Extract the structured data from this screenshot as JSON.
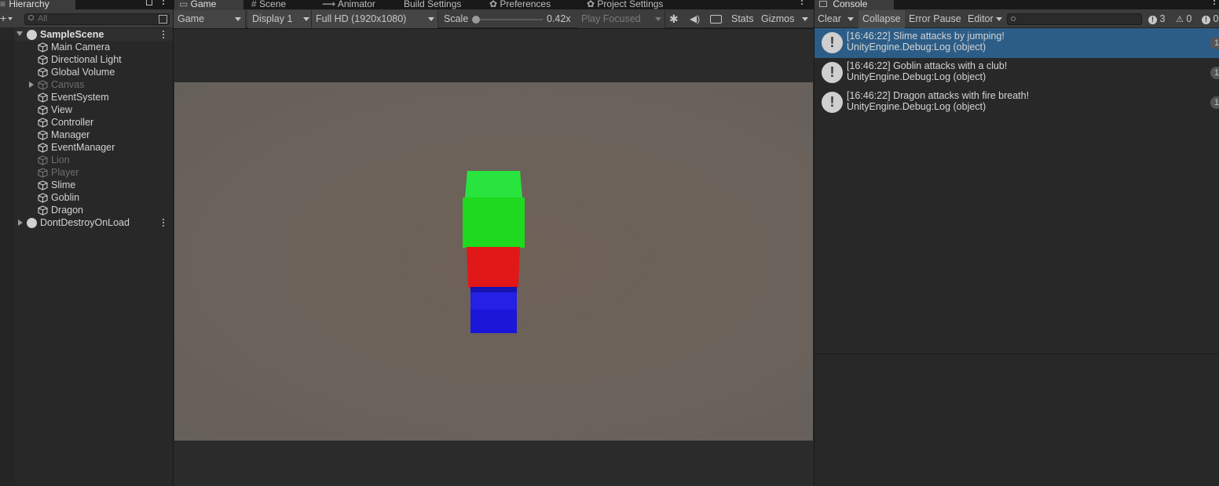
{
  "hierarchy": {
    "tab_label": "Hierarchy",
    "search_placeholder": "All",
    "scene_name": "SampleScene",
    "items": [
      {
        "label": "Main Camera",
        "dim": false
      },
      {
        "label": "Directional Light",
        "dim": false
      },
      {
        "label": "Global Volume",
        "dim": false
      },
      {
        "label": "Canvas",
        "dim": true
      },
      {
        "label": "EventSystem",
        "dim": false
      },
      {
        "label": "View",
        "dim": false
      },
      {
        "label": "Controller",
        "dim": false
      },
      {
        "label": "Manager",
        "dim": false
      },
      {
        "label": "EventManager",
        "dim": false
      },
      {
        "label": "Lion",
        "dim": true
      },
      {
        "label": "Player",
        "dim": true
      },
      {
        "label": "Slime",
        "dim": false
      },
      {
        "label": "Goblin",
        "dim": false
      },
      {
        "label": "Dragon",
        "dim": false
      }
    ],
    "dontdestroy_name": "DontDestroyOnLoad"
  },
  "center_tabs": [
    "Game",
    "Scene",
    "Animator",
    "Build Settings",
    "Preferences",
    "Project Settings"
  ],
  "game_toolbar": {
    "view_mode": "Game",
    "display": "Display 1",
    "resolution": "Full HD (1920x1080)",
    "scale_label": "Scale",
    "scale_value": "0.42x",
    "play_mode": "Play Focused",
    "stats": "Stats",
    "gizmos": "Gizmos"
  },
  "game_view": {
    "background_color": "#6b625b",
    "cubes": [
      {
        "name": "green-cube",
        "color": "#1ed91e"
      },
      {
        "name": "red-cube",
        "color": "#e01818"
      },
      {
        "name": "blue-cube",
        "color": "#1c16d8"
      }
    ]
  },
  "console": {
    "tab_label": "Console",
    "clear": "Clear",
    "collapse": "Collapse",
    "error_pause": "Error Pause",
    "editor": "Editor",
    "count_info": "3",
    "count_warn": "0",
    "count_error": "0",
    "messages": [
      {
        "line1": "[16:46:22] Slime attacks by jumping!",
        "line2": "UnityEngine.Debug:Log (object)",
        "count": "1",
        "selected": true
      },
      {
        "line1": "[16:46:22] Goblin attacks with a club!",
        "line2": "UnityEngine.Debug:Log (object)",
        "count": "1",
        "selected": false
      },
      {
        "line1": "[16:46:22] Dragon attacks with fire breath!",
        "line2": "UnityEngine.Debug:Log (object)",
        "count": "1",
        "selected": false
      }
    ],
    "selected_color": "#2c5d87"
  }
}
